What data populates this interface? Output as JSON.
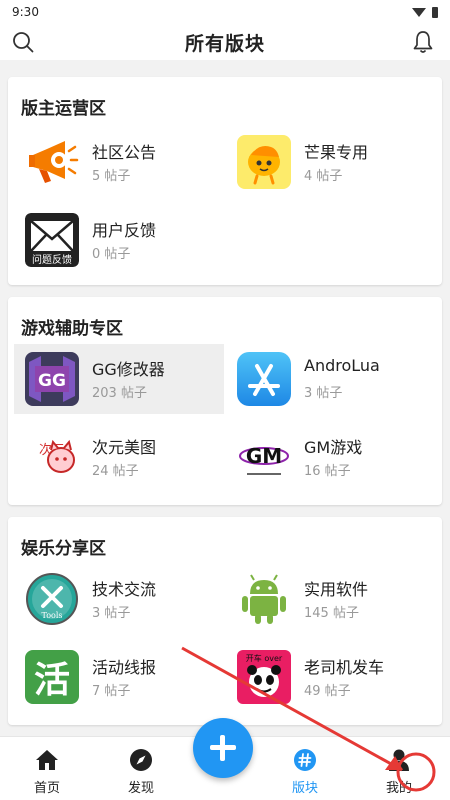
{
  "status_bar": {
    "time": "9:30"
  },
  "header": {
    "title": "所有版块"
  },
  "sections": [
    {
      "title": "版主运营区",
      "items": [
        {
          "name": "社区公告",
          "count": "5 帖子",
          "icon": "megaphone-icon"
        },
        {
          "name": "芒果专用",
          "count": "4 帖子",
          "icon": "mango-icon"
        },
        {
          "name": "用户反馈",
          "count": "0 帖子",
          "icon": "mail-icon",
          "icon_text": "问题反馈"
        }
      ]
    },
    {
      "title": "游戏辅助专区",
      "items": [
        {
          "name": "GG修改器",
          "count": "203 帖子",
          "icon": "gg-icon",
          "icon_text": "GG"
        },
        {
          "name": "AndroLua",
          "count": "3 帖子",
          "icon": "app-store-icon"
        },
        {
          "name": "次元美图",
          "count": "24 帖子",
          "icon": "anime-art-icon",
          "icon_text": "次元"
        },
        {
          "name": "GM游戏",
          "count": "16 帖子",
          "icon": "gm-logo-icon",
          "icon_text": "GM"
        }
      ]
    },
    {
      "title": "娱乐分享区",
      "items": [
        {
          "name": "技术交流",
          "count": "3 帖子",
          "icon": "tools-icon",
          "icon_text": "Tools"
        },
        {
          "name": "实用软件",
          "count": "145 帖子",
          "icon": "android-icon"
        },
        {
          "name": "活动线报",
          "count": "7 帖子",
          "icon": "huo-icon",
          "icon_text": "活"
        },
        {
          "name": "老司机发车",
          "count": "49 帖子",
          "icon": "panda-meme-icon",
          "icon_text": "开车 over"
        }
      ]
    }
  ],
  "bottom_nav": {
    "home": "首页",
    "discover": "发现",
    "boards": "版块",
    "me": "我的"
  },
  "colors": {
    "accent": "#2196f3",
    "annotation": "#e53935"
  }
}
